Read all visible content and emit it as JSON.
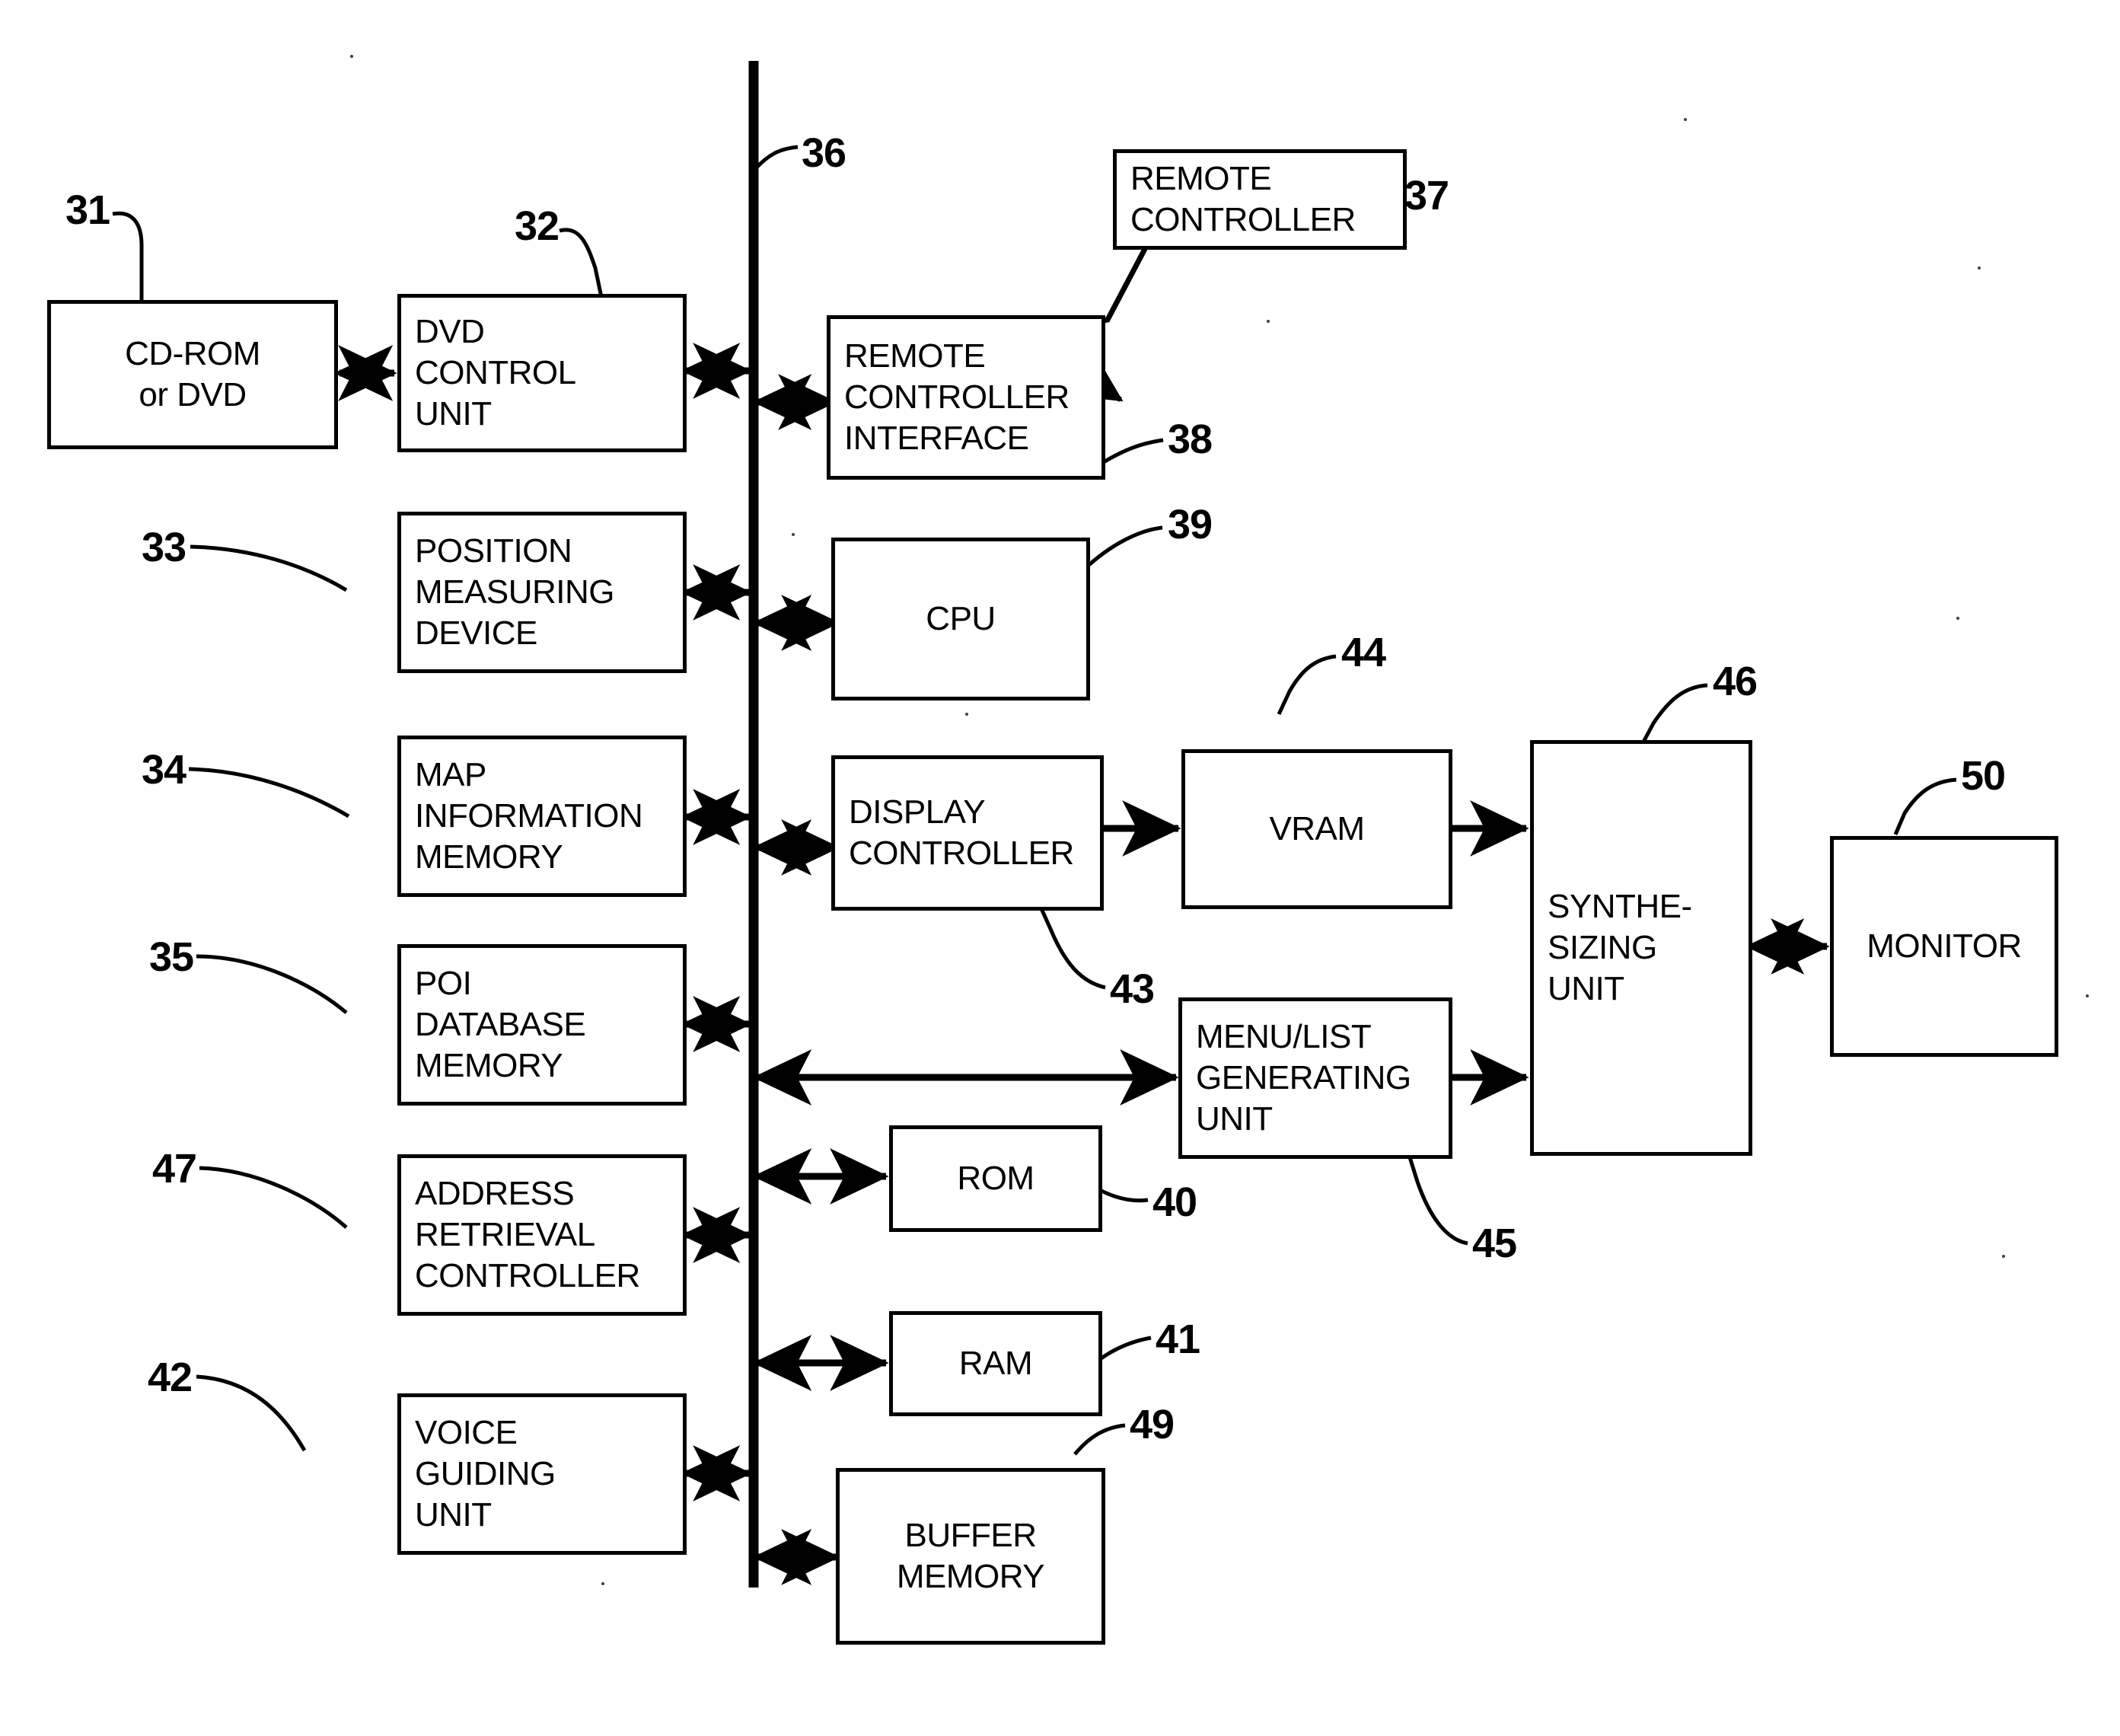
{
  "figure": {
    "type": "patent-block-diagram",
    "title": "",
    "background_color": "#ffffff",
    "line_color": "#000000"
  },
  "blocks": [
    {
      "id": "cdrom",
      "ref": "31",
      "lines": [
        "CD-ROM",
        "or DVD"
      ],
      "align": "center"
    },
    {
      "id": "dvdctrl",
      "ref": "32",
      "lines": [
        "DVD",
        "CONTROL",
        "UNIT"
      ],
      "align": "left"
    },
    {
      "id": "position",
      "ref": "33",
      "lines": [
        "POSITION",
        "MEASURING",
        "DEVICE"
      ],
      "align": "left"
    },
    {
      "id": "mapinfo",
      "ref": "34",
      "lines": [
        "MAP",
        "INFORMATION",
        "MEMORY"
      ],
      "align": "left"
    },
    {
      "id": "poi",
      "ref": "35",
      "lines": [
        "POI",
        "DATABASE",
        "MEMORY"
      ],
      "align": "left"
    },
    {
      "id": "address",
      "ref": "47",
      "lines": [
        "ADDRESS",
        "RETRIEVAL",
        "CONTROLLER"
      ],
      "align": "left"
    },
    {
      "id": "voice",
      "ref": "42",
      "lines": [
        "VOICE",
        "GUIDING",
        "UNIT"
      ],
      "align": "left"
    },
    {
      "id": "remotectl",
      "ref": "37",
      "lines": [
        "REMOTE",
        "CONTROLLER"
      ],
      "align": "left"
    },
    {
      "id": "remoteif",
      "ref": "38",
      "lines": [
        "REMOTE",
        "CONTROLLER",
        "INTERFACE"
      ],
      "align": "left"
    },
    {
      "id": "cpu",
      "ref": "39",
      "lines": [
        "CPU"
      ],
      "align": "center"
    },
    {
      "id": "dispctrl",
      "ref": "43",
      "lines": [
        "DISPLAY",
        "CONTROLLER"
      ],
      "align": "left"
    },
    {
      "id": "rom",
      "ref": "40",
      "lines": [
        "ROM"
      ],
      "align": "center"
    },
    {
      "id": "ram",
      "ref": "41",
      "lines": [
        "RAM"
      ],
      "align": "center"
    },
    {
      "id": "buffer",
      "ref": "49",
      "lines": [
        "BUFFER",
        "MEMORY"
      ],
      "align": "center"
    },
    {
      "id": "vram",
      "ref": "44",
      "lines": [
        "VRAM"
      ],
      "align": "center"
    },
    {
      "id": "menulist",
      "ref": "45",
      "lines": [
        "MENU/LIST",
        "GENERATING",
        "UNIT"
      ],
      "align": "left"
    },
    {
      "id": "synth",
      "ref": "46",
      "lines": [
        "SYNTHE-",
        "SIZING",
        "UNIT"
      ],
      "align": "left"
    },
    {
      "id": "monitor",
      "ref": "50",
      "lines": [
        "MONITOR"
      ],
      "align": "center"
    }
  ],
  "bus": {
    "ref": "36",
    "label": "36"
  },
  "labels": {
    "cdrom_l1": "CD-ROM",
    "cdrom_l2": "or DVD",
    "dvdctrl_l1": "DVD",
    "dvdctrl_l2": "CONTROL",
    "dvdctrl_l3": "UNIT",
    "position_l1": "POSITION",
    "position_l2": "MEASURING",
    "position_l3": "DEVICE",
    "mapinfo_l1": "MAP",
    "mapinfo_l2": "INFORMATION",
    "mapinfo_l3": "MEMORY",
    "poi_l1": "POI",
    "poi_l2": "DATABASE",
    "poi_l3": "MEMORY",
    "address_l1": "ADDRESS",
    "address_l2": "RETRIEVAL",
    "address_l3": "CONTROLLER",
    "voice_l1": "VOICE",
    "voice_l2": "GUIDING",
    "voice_l3": "UNIT",
    "remotectl_l1": "REMOTE",
    "remotectl_l2": "CONTROLLER",
    "remoteif_l1": "REMOTE",
    "remoteif_l2": "CONTROLLER",
    "remoteif_l3": "INTERFACE",
    "cpu_l1": "CPU",
    "dispctrl_l1": "DISPLAY",
    "dispctrl_l2": "CONTROLLER",
    "rom_l1": "ROM",
    "ram_l1": "RAM",
    "buffer_l1": "BUFFER",
    "buffer_l2": "MEMORY",
    "vram_l1": "VRAM",
    "menulist_l1": "MENU/LIST",
    "menulist_l2": "GENERATING",
    "menulist_l3": "UNIT",
    "synth_l1": "SYNTHE-",
    "synth_l2": "SIZING",
    "synth_l3": "UNIT",
    "monitor_l1": "MONITOR"
  },
  "reference_numerals": {
    "n31": "31",
    "n32": "32",
    "n33": "33",
    "n34": "34",
    "n35": "35",
    "n36": "36",
    "n37": "37",
    "n38": "38",
    "n39": "39",
    "n40": "40",
    "n41": "41",
    "n42": "42",
    "n43": "43",
    "n44": "44",
    "n45": "45",
    "n46": "46",
    "n47": "47",
    "n49": "49",
    "n50": "50"
  },
  "connections": [
    {
      "from": "cdrom",
      "to": "dvdctrl",
      "style": "double-arrow"
    },
    {
      "from": "dvdctrl",
      "to": "bus",
      "style": "double-arrow"
    },
    {
      "from": "bus",
      "to": "remoteif",
      "style": "double-arrow"
    },
    {
      "from": "remotectl",
      "to": "remoteif",
      "style": "zigzag-arrow"
    },
    {
      "from": "position",
      "to": "bus",
      "style": "double-arrow"
    },
    {
      "from": "bus",
      "to": "cpu",
      "style": "double-arrow"
    },
    {
      "from": "mapinfo",
      "to": "bus",
      "style": "double-arrow"
    },
    {
      "from": "bus",
      "to": "dispctrl",
      "style": "double-arrow"
    },
    {
      "from": "dispctrl",
      "to": "vram",
      "style": "single-arrow"
    },
    {
      "from": "vram",
      "to": "synth",
      "style": "single-arrow"
    },
    {
      "from": "poi",
      "to": "bus",
      "style": "double-arrow"
    },
    {
      "from": "bus",
      "to": "menulist",
      "style": "double-arrow"
    },
    {
      "from": "menulist",
      "to": "synth",
      "style": "single-arrow"
    },
    {
      "from": "synth",
      "to": "monitor",
      "style": "double-arrow"
    },
    {
      "from": "address",
      "to": "bus",
      "style": "double-arrow"
    },
    {
      "from": "bus",
      "to": "rom",
      "style": "double-arrow"
    },
    {
      "from": "bus",
      "to": "ram",
      "style": "double-arrow"
    },
    {
      "from": "voice",
      "to": "bus",
      "style": "double-arrow"
    },
    {
      "from": "bus",
      "to": "buffer",
      "style": "double-arrow"
    }
  ]
}
